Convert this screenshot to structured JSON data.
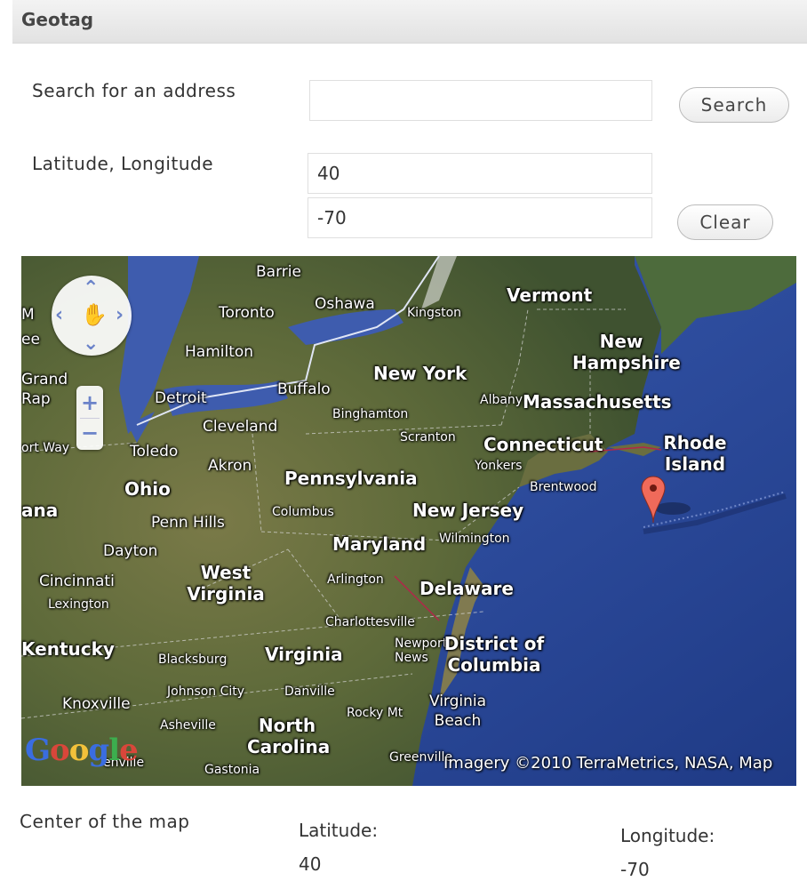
{
  "header": {
    "title": "Geotag"
  },
  "search": {
    "label": "Search for an address",
    "value": "",
    "placeholder": "",
    "button_label": "Search"
  },
  "coords": {
    "label": "Latitude, Longitude",
    "latitude": "40",
    "longitude": "-70",
    "clear_label": "Clear"
  },
  "map": {
    "states": [
      "Vermont",
      "New Hampshire",
      "New York",
      "Massachusetts",
      "Connecticut",
      "Rhode Island",
      "Ohio",
      "Pennsylvania",
      "New Jersey",
      "Maryland",
      "West Virginia",
      "Delaware",
      "Kentucky",
      "Virginia",
      "District of Columbia",
      "North Carolina"
    ],
    "cities": [
      "Barrie",
      "Oshawa",
      "Toronto",
      "Kingston",
      "Hamilton",
      "Buffalo",
      "Detroit",
      "Cleveland",
      "Toledo",
      "Akron",
      "Binghamton",
      "Albany",
      "Scranton",
      "Yonkers",
      "Brentwood",
      "Columbus",
      "Penn Hills",
      "Wilmington",
      "Dayton",
      "Cincinnati",
      "Lexington",
      "Arlington",
      "Charlottesville",
      "Newport News",
      "Blacksburg",
      "Johnson City",
      "Danville",
      "Knoxville",
      "Asheville",
      "Rocky Mt",
      "Virginia Beach",
      "Greenville",
      "Gastonia"
    ],
    "partial_labels": [
      "M",
      "ee",
      "Grand Rap",
      "ort Way",
      "ana",
      "enville"
    ],
    "logo": "Google",
    "copyright": "Imagery ©2010 TerraMetrics, NASA, Map",
    "marker_icon": "map-marker-icon",
    "controls": {
      "pan_icon": "hand-icon",
      "zoom_in": "+",
      "zoom_out": "−"
    }
  },
  "center": {
    "label": "Center of the map",
    "lat_label": "Latitude:",
    "lat_value": "40",
    "lng_label": "Longitude:",
    "lng_value": "-70"
  }
}
